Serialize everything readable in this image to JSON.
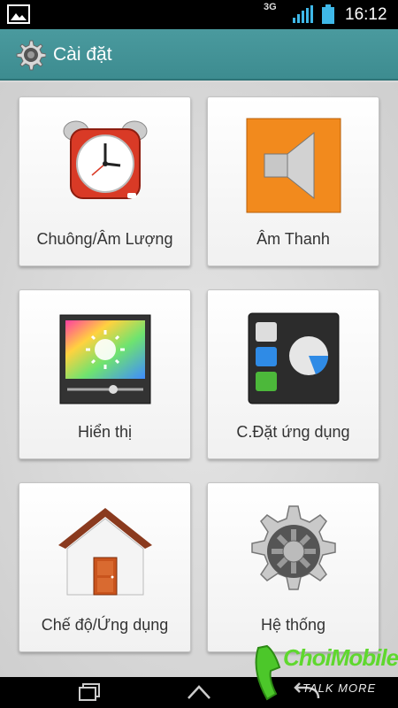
{
  "status_bar": {
    "network_type": "3G",
    "time": "16:12",
    "icons": [
      "gallery-icon",
      "signal-icon",
      "battery-icon"
    ]
  },
  "action_bar": {
    "title": "Cài đặt",
    "icon": "settings-gear-icon"
  },
  "tiles": [
    {
      "label": "Chuông/Âm Lượng",
      "icon": "alarm-clock-icon"
    },
    {
      "label": "Âm Thanh",
      "icon": "speaker-icon"
    },
    {
      "label": "Hiển thị",
      "icon": "display-brightness-icon"
    },
    {
      "label": "C.Đặt ứng dụng",
      "icon": "app-settings-icon"
    },
    {
      "label": "Chế độ/Ứng dụng",
      "icon": "home-icon"
    },
    {
      "label": "Hệ thống",
      "icon": "system-gear-icon"
    }
  ],
  "nav_bar": {
    "buttons": [
      "recent-apps-icon",
      "home-nav-icon",
      "back-icon"
    ]
  },
  "watermark": {
    "brand": "ChoiMobile",
    "tagline": "TALK MORE"
  },
  "colors": {
    "action_bar": "#4a9a9e",
    "tile_bg": "#ffffff",
    "background": "#d9d9d9"
  }
}
